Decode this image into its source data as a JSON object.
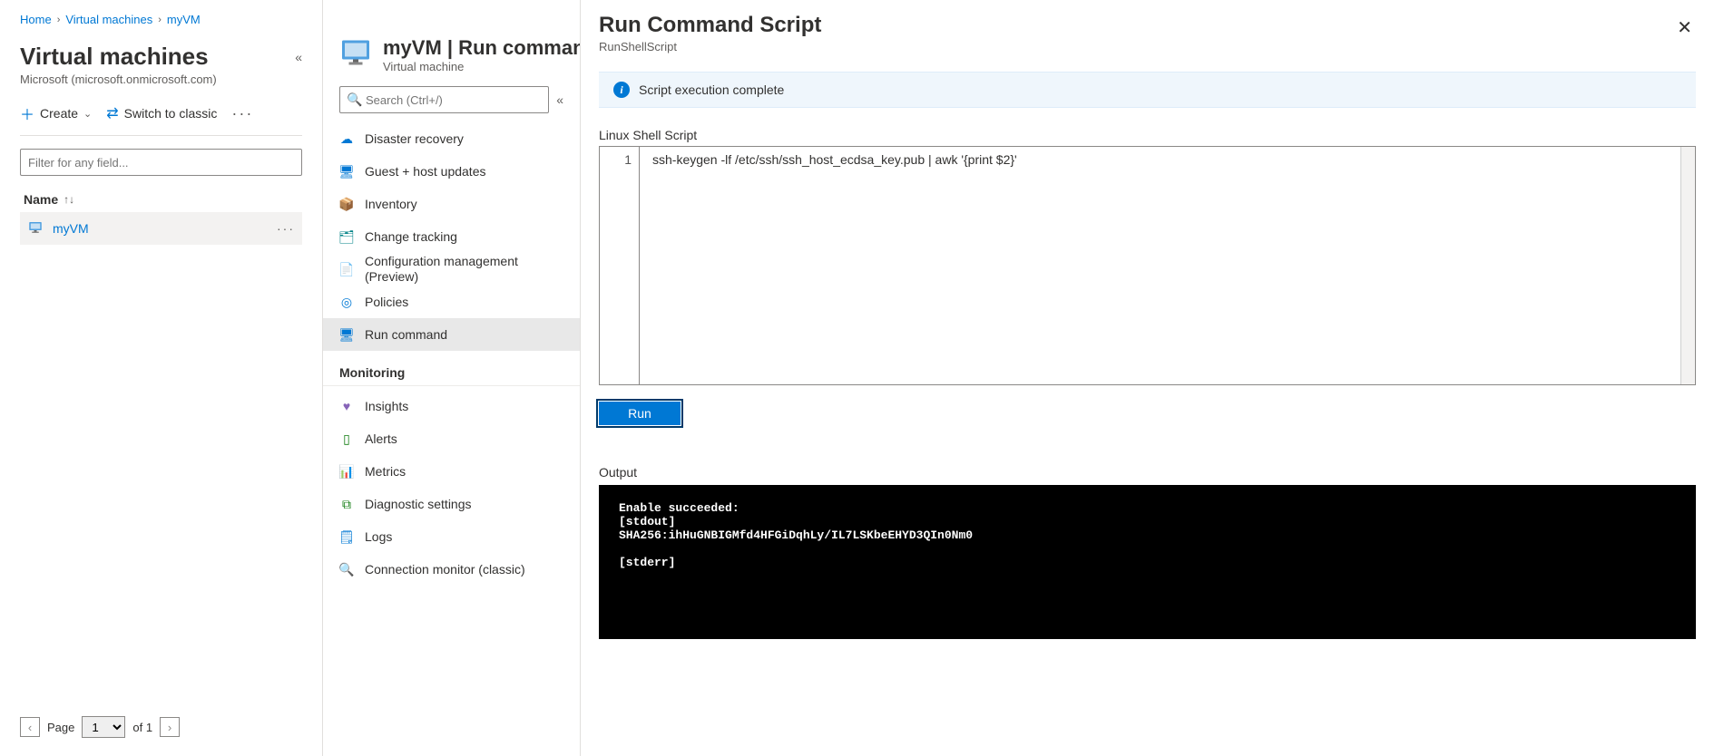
{
  "breadcrumb": {
    "home": "Home",
    "vms": "Virtual machines",
    "vm": "myVM"
  },
  "col1": {
    "title": "Virtual machines",
    "subtitle": "Microsoft (microsoft.onmicrosoft.com)",
    "create": "Create",
    "switch": "Switch to classic",
    "filter_placeholder": "Filter for any field...",
    "name_header": "Name",
    "vm_name": "myVM",
    "pager_page": "Page",
    "pager_value": "1",
    "pager_of": "of 1"
  },
  "col2": {
    "title": "myVM | Run command",
    "subtitle": "Virtual machine",
    "search_placeholder": "Search (Ctrl+/)",
    "section_monitoring": "Monitoring",
    "items": [
      {
        "label": "Disaster recovery",
        "icon": "☁",
        "color": "blue"
      },
      {
        "label": "Guest + host updates",
        "icon": "🖥",
        "color": "blue"
      },
      {
        "label": "Inventory",
        "icon": "📦",
        "color": "orange"
      },
      {
        "label": "Change tracking",
        "icon": "🗂",
        "color": "teal"
      },
      {
        "label": "Configuration management (Preview)",
        "icon": "📄",
        "color": "blue"
      },
      {
        "label": "Policies",
        "icon": "◎",
        "color": "blue"
      },
      {
        "label": "Run command",
        "icon": "🖥",
        "color": "blue",
        "active": true
      }
    ],
    "monitoring_items": [
      {
        "label": "Insights",
        "icon": "♥",
        "color": "purple"
      },
      {
        "label": "Alerts",
        "icon": "▯",
        "color": "green"
      },
      {
        "label": "Metrics",
        "icon": "📊",
        "color": "blue"
      },
      {
        "label": "Diagnostic settings",
        "icon": "⧉",
        "color": "green"
      },
      {
        "label": "Logs",
        "icon": "🗒",
        "color": "blue"
      },
      {
        "label": "Connection monitor (classic)",
        "icon": "🔍",
        "color": "blue"
      }
    ]
  },
  "panel": {
    "title": "Run Command Script",
    "subtitle": "RunShellScript",
    "info": "Script execution complete",
    "script_label": "Linux Shell Script",
    "script_line_no": "1",
    "script_code": "ssh-keygen -lf /etc/ssh/ssh_host_ecdsa_key.pub | awk '{print $2}'",
    "run": "Run",
    "output_label": "Output",
    "output_text": "Enable succeeded: \n[stdout]\nSHA256:ihHuGNBIGMfd4HFGiDqhLy/IL7LSKbeEHYD3QIn0Nm0\n\n[stderr]"
  }
}
